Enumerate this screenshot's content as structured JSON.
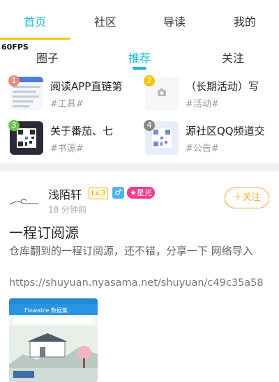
{
  "top_tabs": [
    {
      "label": "首页",
      "active": true
    },
    {
      "label": "社区",
      "active": false
    },
    {
      "label": "导读",
      "active": false
    },
    {
      "label": "我的",
      "active": false
    }
  ],
  "fps": "60FPS",
  "sub_tabs": [
    {
      "label": "圈子",
      "active": false
    },
    {
      "label": "推荐",
      "active": true
    },
    {
      "label": "关注",
      "active": false
    }
  ],
  "featured": [
    {
      "rank": "1",
      "title": "阅读APP直链第",
      "tag": "#工具#",
      "rank_color": "#f08b7a"
    },
    {
      "rank": "2",
      "title": "（长期活动）写",
      "tag": "#活动#",
      "rank_color": "#f5c400"
    },
    {
      "rank": "3",
      "title": "关于番茄、七",
      "tag": "#书源#",
      "rank_color": "#6cc84a"
    },
    {
      "rank": "4",
      "title": "源社区QQ频道交",
      "tag": "#公告#",
      "rank_color": "#888888"
    }
  ],
  "post": {
    "author": "浅陌轩",
    "level": "Lv.3",
    "gender_icon": "♂",
    "badge": "★星光",
    "time": "18 分钟前",
    "follow_label": "＋关注",
    "title": "一程订阅源",
    "body": "仓库翻到的一程订阅源，还不错，分享一下 网络导入",
    "link": "https://shuyuan.nyasama.net/shuyuan/c49c35a58",
    "shot_header": "Flowable 数据集"
  },
  "colors": {
    "accent": "#22b9d6",
    "indicator": "#f5c400",
    "follow": "#f2a93b",
    "badge": "#f03c8e"
  }
}
